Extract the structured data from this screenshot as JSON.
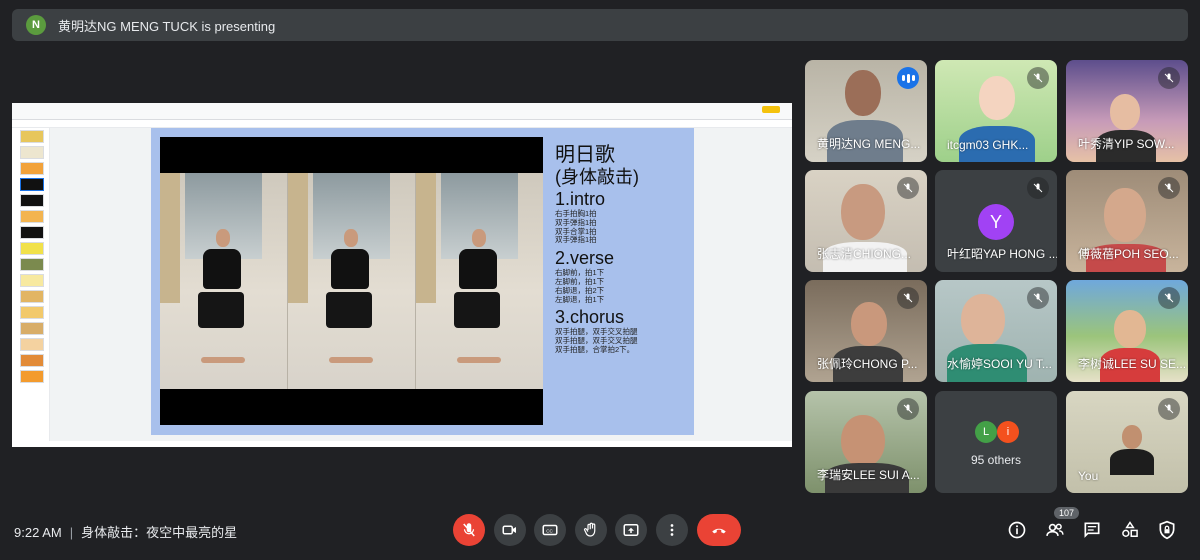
{
  "banner": {
    "avatar_letter": "N",
    "text": "黄明达NG MENG TUCK is presenting"
  },
  "presentation": {
    "slide": {
      "title": "明日歌",
      "subtitle": "(身体敲击)",
      "section1_title": "1.intro",
      "section1_lines": [
        "右手拍胸1拍",
        "双手弹指1拍",
        "双手合掌1拍",
        "双手弹指1拍"
      ],
      "section2_title": "2.verse",
      "section2_lines": [
        "右脚前，拍1下",
        "左脚前，拍1下",
        "右脚退，拍2下",
        "左脚退，拍1下"
      ],
      "section3_title": "3.chorus",
      "section3_lines": [
        "双手拍腿，双手交叉拍腿",
        "双手拍腿，双手交叉拍腿",
        "双手拍腿，合掌拍2下。"
      ]
    }
  },
  "participants": [
    {
      "name": "黄明达NG MENG...",
      "speaking": true
    },
    {
      "name": "itcgm03 GHK...",
      "muted": true
    },
    {
      "name": "叶秀清YIP SOW...",
      "muted": true
    },
    {
      "name": "张志清CHIONG...",
      "muted": true
    },
    {
      "name": "叶红昭YAP HONG ...",
      "muted": true,
      "avatar_letter": "Y"
    },
    {
      "name": "傅薇蓓POH SEO...",
      "muted": true
    },
    {
      "name": "张佩玲CHONG P...",
      "muted": true
    },
    {
      "name": "水愉婷SOOI YU T...",
      "muted": true
    },
    {
      "name": "李树诚LEE SU SE...",
      "muted": true
    },
    {
      "name": "李瑞安LEE SUI A...",
      "muted": true
    },
    {
      "name": "95 others",
      "avatars": [
        "L",
        "i"
      ]
    },
    {
      "name": "You",
      "muted": true
    }
  ],
  "bottom": {
    "time": "9:22 AM",
    "separator": "|",
    "meeting_title": "身体敲击：夜空中最亮的星",
    "people_count": "107"
  },
  "colors": {
    "background": "#202124",
    "surface": "#3c4043",
    "danger": "#ea4335",
    "accent": "#1a73e8",
    "slide_bg": "#a8c0ec"
  }
}
